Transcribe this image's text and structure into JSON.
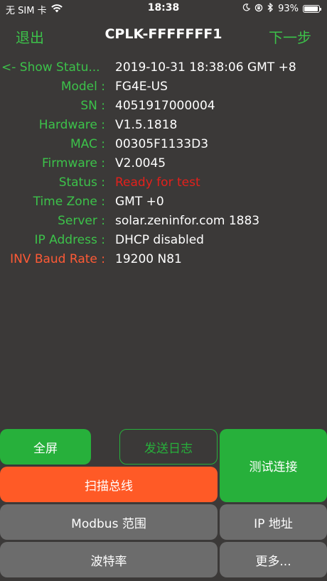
{
  "status_bar": {
    "carrier": "无 SIM 卡",
    "time": "18:38",
    "battery": "93%",
    "battery_level": 0.93
  },
  "nav": {
    "left": "退出",
    "title": "CPLK-FFFFFFF1",
    "right": "下一步"
  },
  "info": {
    "show_status_label": "<- Show Statu...",
    "show_status_value": "2019-10-31 18:38:06 GMT +8",
    "rows": [
      {
        "label": "Model :",
        "value": "FG4E-US"
      },
      {
        "label": "SN :",
        "value": "4051917000004"
      },
      {
        "label": "Hardware :",
        "value": "V1.5.1818"
      },
      {
        "label": "MAC :",
        "value": "00305F1133D3"
      },
      {
        "label": "Firmware :",
        "value": "V2.0045"
      },
      {
        "label": "Status :",
        "value": "Ready for test"
      },
      {
        "label": "Time Zone :",
        "value": "GMT +0"
      },
      {
        "label": "Server :",
        "value": "solar.zeninfor.com 1883"
      },
      {
        "label": "IP Address :",
        "value": "DHCP disabled"
      },
      {
        "label": "INV Baud Rate :",
        "value": "19200 N81"
      }
    ]
  },
  "buttons": {
    "fullscreen": "全屏",
    "send_log": "发送日志",
    "test_connect": "测试连接",
    "scan_bus": "扫描总线",
    "modbus_range": "Modbus 范围",
    "ip_address": "IP 地址",
    "baud_rate": "波特率",
    "more": "更多..."
  },
  "colors": {
    "green": "#27b03b",
    "orange": "#ff5a26",
    "red": "#e3201b",
    "gray": "#6c6c6c",
    "background": "#3b3938"
  }
}
